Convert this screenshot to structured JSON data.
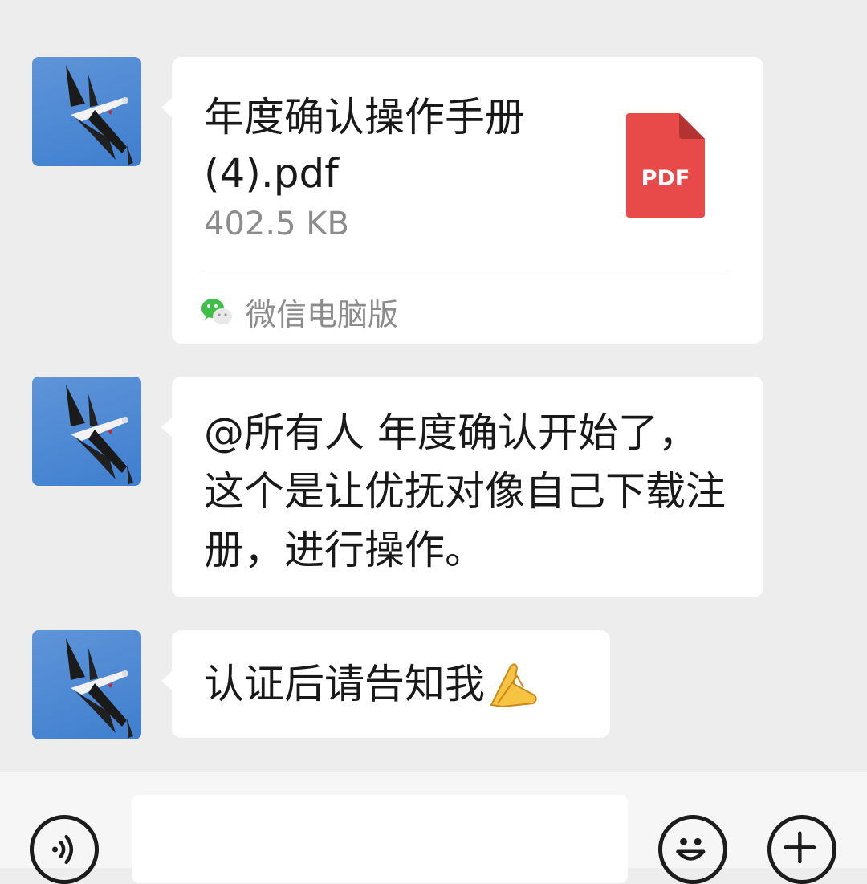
{
  "messages": [
    {
      "type": "file",
      "file_name": "年度确认操作手册(4).pdf",
      "file_size": "402.5 KB",
      "file_type_label": "PDF",
      "source_label": "微信电脑版"
    },
    {
      "type": "text",
      "text": "@所有人  年度确认开始了，这个是让优抚对像自己下载注册，进行操作。"
    },
    {
      "type": "text",
      "text": "认证后请告知我",
      "emoji": "folded-hands-emoji"
    }
  ],
  "input_bar": {
    "placeholder": "",
    "icons": [
      "voice-icon",
      "smiley-icon",
      "plus-icon"
    ]
  },
  "colors": {
    "background": "#ededed",
    "bubble": "#ffffff",
    "pdf_red": "#e84a4a",
    "secondary_text": "#8c8c8c",
    "avatar_sky": "#4a86d3"
  }
}
